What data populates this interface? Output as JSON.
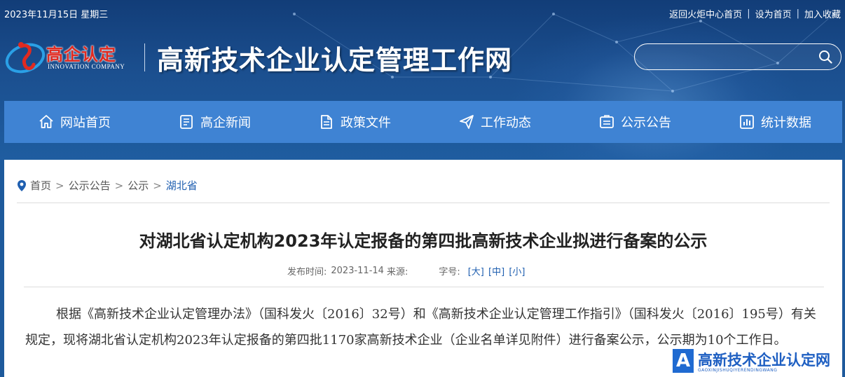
{
  "topbar": {
    "date": "2023年11月15日 星期三",
    "links": [
      "返回火炬中心首页",
      "设为首页",
      "加入收藏"
    ],
    "separator": "|"
  },
  "logo": {
    "cn": "高企认定",
    "en": "INNOVATION COMPANY"
  },
  "site_title": "高新技术企业认定管理工作网",
  "search": {
    "placeholder": "",
    "icon": "search-icon"
  },
  "nav": {
    "items": [
      {
        "label": "网站首页",
        "icon": "home-icon"
      },
      {
        "label": "高企新闻",
        "icon": "news-icon"
      },
      {
        "label": "政策文件",
        "icon": "document-icon"
      },
      {
        "label": "工作动态",
        "icon": "send-icon"
      },
      {
        "label": "公示公告",
        "icon": "notice-icon"
      },
      {
        "label": "统计数据",
        "icon": "chart-icon"
      }
    ]
  },
  "breadcrumb": {
    "icon": "location-pin-icon",
    "items": [
      "首页",
      "公示公告",
      "公示",
      "湖北省"
    ],
    "separator": ">"
  },
  "article": {
    "title": "对湖北省认定机构2023年认定报备的第四批高新技术企业拟进行备案的公示",
    "meta": {
      "publish_label": "发布时间:",
      "publish_date": "2023-11-14",
      "source_label": "来源:",
      "font_label": "字号:",
      "font_sizes": [
        "[大]",
        "[中]",
        "[小]"
      ]
    },
    "body": "根据《高新技术企业认定管理办法》（国科发火〔2016〕32号）和《高新技术企业认定管理工作指引》（国科发火〔2016〕195号）有关规定，现将湖北省认定机构2023年认定报备的第四批1170家高新技术企业（企业名单详见附件）进行备案公示，公示期为10个工作日。"
  },
  "watermark": {
    "icon_letter": "A",
    "title": "高新技术企业认定网",
    "sub": "GAOXINJISHUQIYERENDINGWANG"
  },
  "colors": {
    "header_bg": "#1b4f8f",
    "nav_bg": "#3f83d3",
    "link_blue": "#1f5fb0",
    "logo_red": "#e02a20"
  }
}
